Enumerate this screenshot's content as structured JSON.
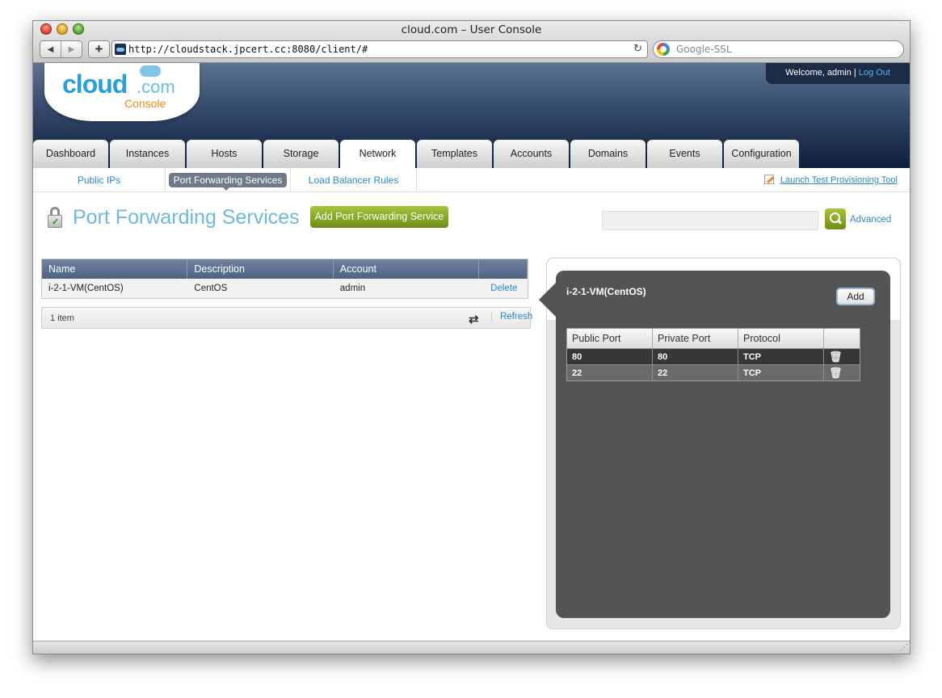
{
  "browser": {
    "window_title": "cloud.com – User Console",
    "back_icon": "◀",
    "forward_icon": "▶",
    "add_icon": "+",
    "url": "http://cloudstack.jpcert.cc:8080/client/#",
    "reload_icon": "↻",
    "search_placeholder": "Google-SSL"
  },
  "logo": {
    "brand": "cloud",
    "tld": ".com",
    "product": "Console"
  },
  "user": {
    "welcome": "Welcome, admin",
    "separator": "|",
    "logout": "Log Out"
  },
  "tabs": [
    {
      "label": "Dashboard"
    },
    {
      "label": "Instances"
    },
    {
      "label": "Hosts"
    },
    {
      "label": "Storage"
    },
    {
      "label": "Network"
    },
    {
      "label": "Templates"
    },
    {
      "label": "Accounts"
    },
    {
      "label": "Domains"
    },
    {
      "label": "Events"
    },
    {
      "label": "Configuration"
    }
  ],
  "active_tab": "Network",
  "subtabs": [
    {
      "label": "Public IPs"
    },
    {
      "label": "Port Forwarding Services"
    },
    {
      "label": "Load Balancer Rules"
    }
  ],
  "active_subtab": "Port Forwarding Services",
  "launch_tool": "Launch Test Provisioning Tool",
  "page": {
    "title": "Port Forwarding Services",
    "add_button": "Add Port Forwarding Service",
    "search_value": "",
    "advanced_link": "Advanced"
  },
  "grid": {
    "columns": [
      "Name",
      "Description",
      "Account",
      ""
    ],
    "rows": [
      {
        "name": "i-2-1-VM(CentOS)",
        "description": "CentOS",
        "account": "admin",
        "action": "Delete"
      }
    ],
    "item_count": "1 item",
    "refresh": "Refresh"
  },
  "detail": {
    "title": "i-2-1-VM(CentOS)",
    "add_button": "Add",
    "columns": [
      "Public Port",
      "Private Port",
      "Protocol",
      ""
    ],
    "rules": [
      {
        "public_port": "80",
        "private_port": "80",
        "protocol": "TCP"
      },
      {
        "public_port": "22",
        "private_port": "22",
        "protocol": "TCP"
      }
    ]
  },
  "colors": {
    "accent_blue": "#2a88c9",
    "title_blue": "#6cb8de",
    "add_green": "#8aac26",
    "header_navy": "#0e1d38",
    "panel_gray": "#545454"
  }
}
